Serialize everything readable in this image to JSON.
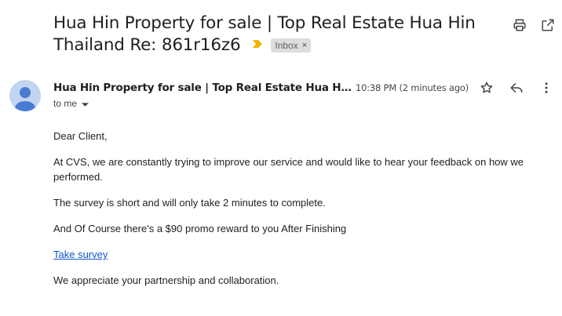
{
  "email": {
    "subject": "Hua Hin Property for sale | Top Real Estate Hua Hin Thailand Re: 861r16z6",
    "label": "Inbox",
    "label_remove": "×",
    "sender": "Hua Hin Property for sale | Top Real Estate Hua Hin Th…",
    "recipient": "to me",
    "time": "10:38 PM (2 minutes ago)",
    "body": {
      "greeting": "Dear Client,",
      "paragraph1": "At CVS, we are constantly trying to improve our service and would like to hear your feedback on how we performed.",
      "paragraph2": "The survey is short and will only take 2 minutes to complete.",
      "paragraph3": "And Of Course there's a $90 promo reward to you After Finishing",
      "link": "Take survey",
      "closing": "We appreciate your partnership and collaboration."
    }
  },
  "icons": {
    "print": "print-icon",
    "popout": "open-in-new-window-icon",
    "importance": "importance-marker-icon",
    "star": "star-icon",
    "reply": "reply-icon",
    "more": "more-vert-icon",
    "avatar": "default-avatar",
    "caret": "caret-down-icon"
  },
  "colors": {
    "importance": "#f4b400",
    "link": "#1155cc",
    "chip_bg": "#dddddd",
    "avatar_bg": "#c2d4f0",
    "avatar_fg": "#4a7bd4"
  }
}
